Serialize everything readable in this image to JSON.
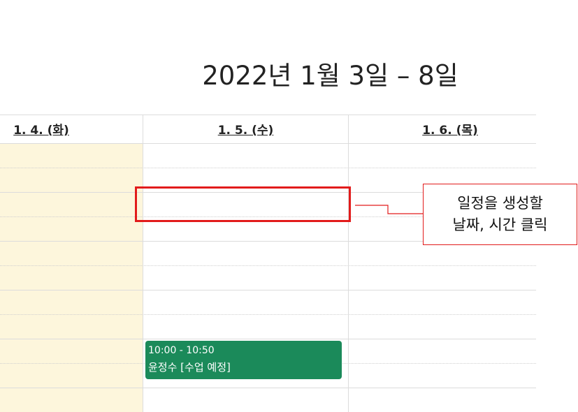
{
  "calendar": {
    "title": "2022년 1월 3일 – 8일",
    "days": [
      {
        "label": "1. 4. (화)"
      },
      {
        "label": "1. 5. (수)"
      },
      {
        "label": "1. 6. (목)"
      }
    ]
  },
  "event": {
    "time": "10:00 - 10:50",
    "title": "윤정수 [수업 예정]",
    "color": "#1b8a5a"
  },
  "annotation": {
    "line1": "일정을 생성할",
    "line2": "날짜, 시간 클릭",
    "color": "#e21b1b"
  },
  "colors": {
    "today_column": "#fdf6dc",
    "grid_line": "#dcdcdc"
  }
}
